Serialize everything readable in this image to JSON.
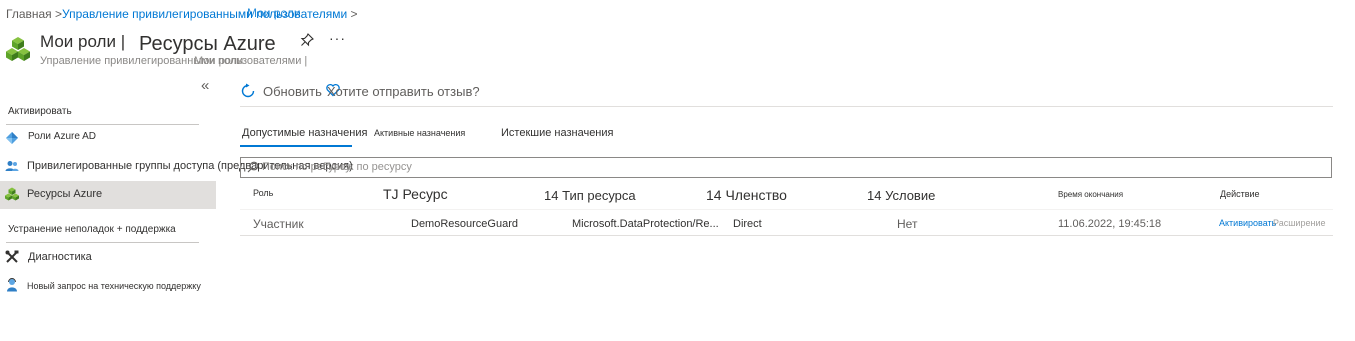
{
  "breadcrumb": {
    "home": "Главная",
    "sep1": " >",
    "pim": "Управление привилегированными пользователями",
    "sep2": " >",
    "current_overlap": "Мои роли"
  },
  "header": {
    "title": "Мои роли |",
    "title_section": "Ресурсы Azure",
    "more_label": "···",
    "subtitle": "Управление привилегированными пользователями |",
    "subtitle_overlap": "Мои роли"
  },
  "sidebar": {
    "collapse_label": "«",
    "activate_heading": "Активировать",
    "items": [
      {
        "label": "Роли Azure AD",
        "icon": "azure-ad-icon"
      },
      {
        "label": "Привилегированные группы доступа (предварительная версия)",
        "icon": "groups-icon"
      },
      {
        "label": "Ресурсы Azure",
        "icon": "azure-resources-icon"
      }
    ],
    "troubleshoot_heading": "Устранение неполадок + поддержка",
    "support_items": [
      {
        "label": "Диагностика",
        "icon": "tools-icon"
      },
      {
        "label": "Новый запрос на техническую поддержку",
        "icon": "support-person-icon"
      }
    ]
  },
  "toolbar": {
    "refresh_label": "Обновить",
    "feedback_label": "Хотите отправить отзыв?"
  },
  "tabs": [
    {
      "label": "Допустимые назначения",
      "active": true
    },
    {
      "label": "Активные назначения",
      "active": false
    },
    {
      "label": "Истекшие назначения",
      "active": false
    }
  ],
  "search": {
    "placeholder_overlap": "Поиск по ресурсу",
    "placeholder": "Поиск по ресурсу"
  },
  "table": {
    "columns": [
      "Роль",
      "TJ Ресурс",
      "14 Тип ресурса",
      "14 Членство",
      "14 Условие",
      "Время окончания",
      "Действие"
    ],
    "rows": [
      {
        "role": "Участник",
        "resource": "DemoResourceGuard",
        "resource_type": "Microsoft.DataProtection/Re...",
        "membership": "Direct",
        "condition": "Нет",
        "end_time": "11.06.2022, 19:45:18",
        "action_activate": "Активировать",
        "action_extend": "Расширение"
      }
    ]
  },
  "colors": {
    "accent": "#0078d4",
    "selected_nav": "#e1dfdd",
    "azure_green": "#5ea429"
  }
}
